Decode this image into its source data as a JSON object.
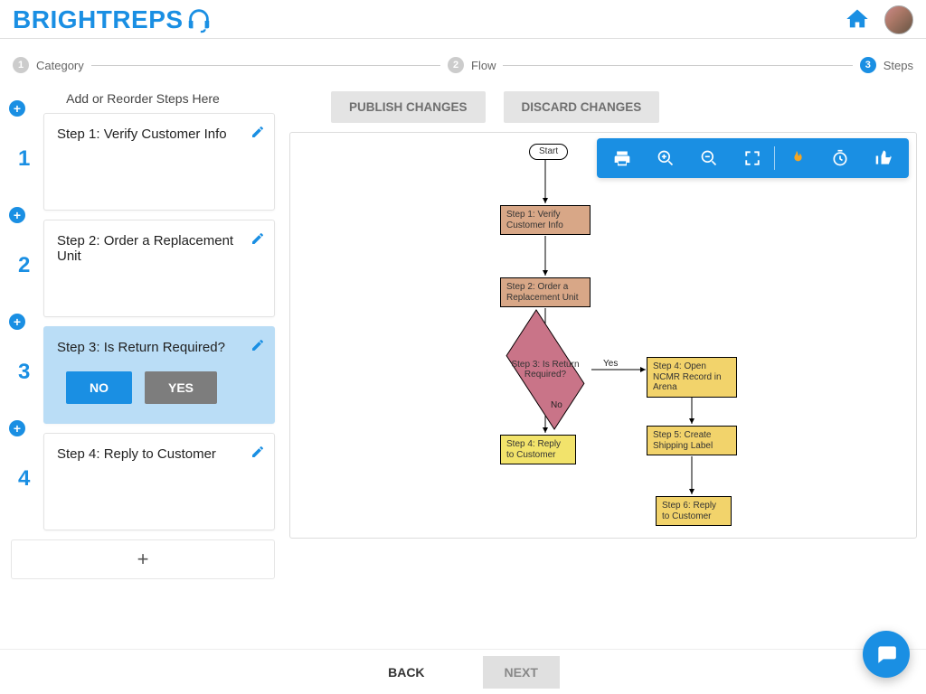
{
  "header": {
    "brand_prefix": "BRIGHTREPS",
    "home_label": "Home"
  },
  "stepper": {
    "s1": {
      "num": "1",
      "label": "Category"
    },
    "s2": {
      "num": "2",
      "label": "Flow"
    },
    "s3": {
      "num": "3",
      "label": "Steps"
    }
  },
  "left": {
    "title": "Add or Reorder Steps Here",
    "steps": [
      {
        "num": "1",
        "title": "Step 1: Verify Customer Info"
      },
      {
        "num": "2",
        "title": "Step 2: Order a Replacement Unit"
      },
      {
        "num": "3",
        "title": "Step 3: Is Return Required?",
        "no": "NO",
        "yes": "YES"
      },
      {
        "num": "4",
        "title": "Step 4: Reply to Customer"
      }
    ],
    "add_icon": "+"
  },
  "actions": {
    "publish": "PUBLISH CHANGES",
    "discard": "DISCARD CHANGES"
  },
  "flow": {
    "start": "Start",
    "n1": "Step 1: Verify Customer Info",
    "n2": "Step 2: Order a Replacement Unit",
    "n3": "Step 3: Is Return Required?",
    "n4": "Step 4: Reply to Customer",
    "n5": "Step 4: Open NCMR Record in Arena",
    "n6": "Step 5: Create Shipping Label",
    "n7": "Step 6: Reply to Customer",
    "yes": "Yes",
    "no": "No"
  },
  "toolbar_icons": {
    "print": "print-icon",
    "zoom_in": "zoom-in-icon",
    "zoom_out": "zoom-out-icon",
    "full": "fullscreen-icon",
    "fire": "fire-icon",
    "timer": "timer-icon",
    "thumb": "thumb-up-icon"
  },
  "footer": {
    "back": "BACK",
    "next": "NEXT"
  }
}
